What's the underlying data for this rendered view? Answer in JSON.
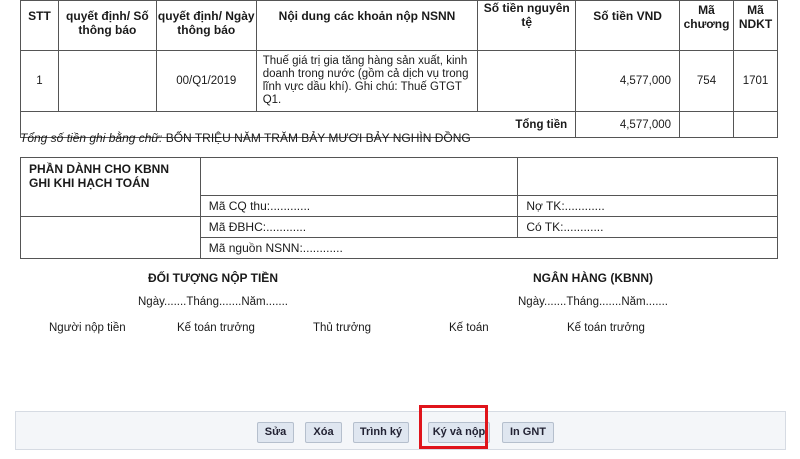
{
  "table": {
    "headers": {
      "stt": "STT",
      "decision_no": "quyết định/ Số thông báo",
      "decision_date": "quyết định/ Ngày thông báo",
      "content": "Nội dung các khoản nộp NSNN",
      "orig_amount": "Số tiền nguyên tệ",
      "vnd_amount": "Số tiền VND",
      "chapter_code": "Mã chương",
      "ndkt_code": "Mã NDKT"
    },
    "rows": [
      {
        "stt": "1",
        "decision_no": "",
        "decision_date": "00/Q1/2019",
        "content": "Thuế giá trị gia tăng hàng sản xuất, kinh doanh trong nước (gồm cả dịch vụ trong lĩnh vực dầu khí). Ghi chú: Thuế GTGT Q1.",
        "orig_amount": "",
        "vnd_amount": "4,577,000",
        "chapter_code": "754",
        "ndkt_code": "1701"
      }
    ],
    "total_label": "Tổng tiền",
    "total_vnd": "4,577,000"
  },
  "amount_in_words": {
    "label": "Tổng số tiền ghi bằng chữ:",
    "value": "BỐN TRIỆU NĂM TRĂM BẢY MƯƠI BẢY NGHÌN ĐỒNG"
  },
  "kbnn": {
    "title": "PHẦN DÀNH CHO KBNN GHI KHI HẠCH TOÁN",
    "ma_cq_thu": "Mã CQ thu:............",
    "ma_dbhc": "Mã ĐBHC:............",
    "ma_nguon": "Mã nguồn NSNN:............",
    "no_tk": "Nợ TK:............",
    "co_tk": "Có TK:............"
  },
  "signatures": {
    "payer_title": "ĐỐI TƯỢNG NỘP TIỀN",
    "bank_title": "NGÂN HÀNG (KBNN)",
    "date_line": "Ngày.......Tháng.......Năm.......",
    "payer_roles": [
      "Người nộp tiền",
      "Kế toán trưởng",
      "Thủ trưởng"
    ],
    "bank_roles": [
      "Kế toán",
      "Kế toán trưởng"
    ]
  },
  "buttons": {
    "edit": "Sửa",
    "delete": "Xóa",
    "submit_sign": "Trình ký",
    "sign_submit": "Ký và nộp",
    "print": "In GNT"
  },
  "highlight_color": "#e0141b"
}
